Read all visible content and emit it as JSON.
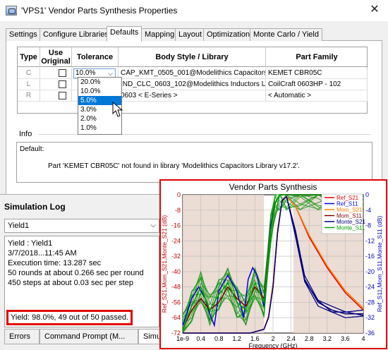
{
  "dialog": {
    "title": "'VPS1' Vendor Parts Synthesis Properties",
    "close_glyph": "✕",
    "tabs": [
      "Settings",
      "Configure Libraries",
      "Defaults",
      "Mapping",
      "Layout",
      "Optimization",
      "Monte Carlo / Yield"
    ],
    "active_tab": "Defaults"
  },
  "grid": {
    "headers": {
      "type": "Type",
      "use_original": "Use Original",
      "tolerance": "Tolerance",
      "body_style": "Body Style / Library",
      "part_family": "Part Family"
    },
    "rows": [
      {
        "type": "C",
        "tolerance": "10.0%",
        "body_style": "CAP_KMT_0505_001@Modelithics Capacitors",
        "part_family": "KEMET CBR05C"
      },
      {
        "type": "L",
        "tolerance": "",
        "body_style": "IND_CLC_0603_102@Modelithics Inductors Li",
        "part_family": "CoilCraft 0603HP - 102"
      },
      {
        "type": "R",
        "tolerance": "",
        "body_style": "0603    < E-Series >",
        "part_family": "< Automatic >"
      }
    ],
    "dropdown_arrow": "⌵",
    "tolerance_options": [
      "20.0%",
      "10.0%",
      "5.0%",
      "3.0%",
      "2.0%",
      "1.0%"
    ],
    "selected_option": "5.0%"
  },
  "info": {
    "label": "Info",
    "default_label": "Default:",
    "message": "Part 'KEMET CBR05C' not found in library 'Modelithics Capacitors Library v17.2'."
  },
  "simlog": {
    "title": "Simulation Log",
    "selected": "Yield1",
    "arrow": "⌵",
    "lines": [
      "Yield : Yield1",
      "3/7/2018...11:45 AM",
      "Execution time: 13.287 sec",
      "50 rounds at about 0.266 sec per round",
      "450 steps at about 0.03 sec per step"
    ],
    "yield_result": "Yield: 98.0%, 49 out of 50 passed.",
    "tabs": [
      "Errors",
      "Command Prompt (M...",
      "Simul"
    ]
  },
  "colors": {
    "accent": "#0078d7",
    "highlight_red": "#e00000",
    "ref_s21": "#e00000",
    "ref_s11": "#0000e0",
    "mom_s21": "#ff8000",
    "mom_s11": "#800000",
    "monte_s21": "#000080",
    "monte_s11": "#00a000",
    "left_axis": "#c00000",
    "right_axis": "#0000c0"
  },
  "chart_data": {
    "type": "line",
    "title": "Vendor Parts Synthesis",
    "xlabel": "Frequency (GHz)",
    "ylabel_left": "Ref_S21,Mom_S21,Monte_S21 (dB)",
    "ylabel_right": "Ref_S11,Mom_S11,Monte_S11 (dB)",
    "xlim": [
      0,
      4
    ],
    "ylim_left": [
      -72,
      0
    ],
    "ylim_right": [
      -36,
      0
    ],
    "x_ticks": [
      "1e-9",
      "0.4",
      "0.8",
      "1.2",
      "1.6",
      "2",
      "2.4",
      "2.8",
      "3.2",
      "3.6",
      "4"
    ],
    "y_left_ticks": [
      "0",
      "-8",
      "-16",
      "-24",
      "-32",
      "-40",
      "-48",
      "-56",
      "-64",
      "-72"
    ],
    "y_right_ticks": [
      "0",
      "-4",
      "-8",
      "-12",
      "-16",
      "-20",
      "-24",
      "-28",
      "-32",
      "-36"
    ],
    "grid": true,
    "legend_position": "top-right",
    "series": [
      {
        "name": "Ref_S21",
        "axis": "left",
        "x": [
          0,
          1.0,
          1.5,
          1.8,
          1.9,
          2.0,
          2.1,
          2.2,
          2.3,
          2.5,
          2.8,
          3.2,
          3.6,
          4.0
        ],
        "y": [
          -72,
          -72,
          -72,
          -70,
          -64,
          -48,
          -20,
          -3,
          -1,
          -6,
          -22,
          -38,
          -51,
          -60
        ]
      },
      {
        "name": "Ref_S11",
        "axis": "right",
        "x": [
          0,
          0.2,
          0.35,
          0.5,
          0.6,
          0.7,
          0.75,
          0.8,
          1.0,
          1.2,
          1.35,
          1.45,
          1.55,
          1.65,
          1.8,
          1.95,
          2.05,
          2.15,
          2.3,
          2.5,
          2.8,
          3.2,
          3.6,
          4.0
        ],
        "y": [
          -34,
          -27,
          -24,
          -27,
          -31,
          -34,
          -30,
          -25,
          -21,
          -25,
          -32,
          -22,
          -19,
          -21,
          -29,
          -8,
          -2,
          0,
          0,
          0,
          0,
          0,
          0,
          0
        ]
      },
      {
        "name": "Mom_S21",
        "axis": "left",
        "x": [
          0,
          1.0,
          1.5,
          1.8,
          1.9,
          2.0,
          2.1,
          2.2,
          2.3,
          2.5,
          2.8,
          3.2,
          3.6,
          4.0
        ],
        "y": [
          -72,
          -72,
          -72,
          -70,
          -63,
          -46,
          -18,
          -3,
          -1,
          -6,
          -21,
          -37,
          -50,
          -59
        ]
      },
      {
        "name": "Mom_S11",
        "axis": "right",
        "x": [
          0,
          0.2,
          0.4,
          0.6,
          0.8,
          1.0,
          1.2,
          1.4,
          1.6,
          1.8,
          1.95,
          2.05,
          2.15,
          2.3,
          2.6,
          3.0,
          3.4,
          4.0
        ],
        "y": [
          -35,
          -30,
          -27,
          -30,
          -28,
          -24,
          -27,
          -29,
          -24,
          -27,
          -9,
          -2,
          0,
          0,
          0,
          0,
          0,
          0
        ]
      },
      {
        "name": "Monte_S21",
        "axis": "left",
        "x": [
          0,
          1.0,
          1.5,
          1.8,
          1.9,
          2.0,
          2.1,
          2.2,
          2.3,
          2.5,
          2.7,
          3.0,
          3.3,
          3.6,
          4.0
        ],
        "y": [
          -72,
          -72,
          -72,
          -70,
          -64,
          -48,
          -20,
          -3,
          -1,
          -20,
          -44,
          -56,
          -60,
          -62,
          -62
        ]
      },
      {
        "name": "Monte_S11",
        "axis": "right",
        "x": [
          0,
          0.2,
          0.4,
          0.6,
          0.8,
          1.0,
          1.2,
          1.4,
          1.6,
          1.8,
          1.95,
          2.05,
          2.15,
          2.3,
          2.6,
          3.0,
          3.4,
          4.0
        ],
        "y": [
          -35,
          -29,
          -24,
          -30,
          -26,
          -23,
          -28,
          -30,
          -23,
          -28,
          -9,
          -2,
          0,
          0,
          0,
          0,
          0,
          0
        ]
      }
    ]
  }
}
